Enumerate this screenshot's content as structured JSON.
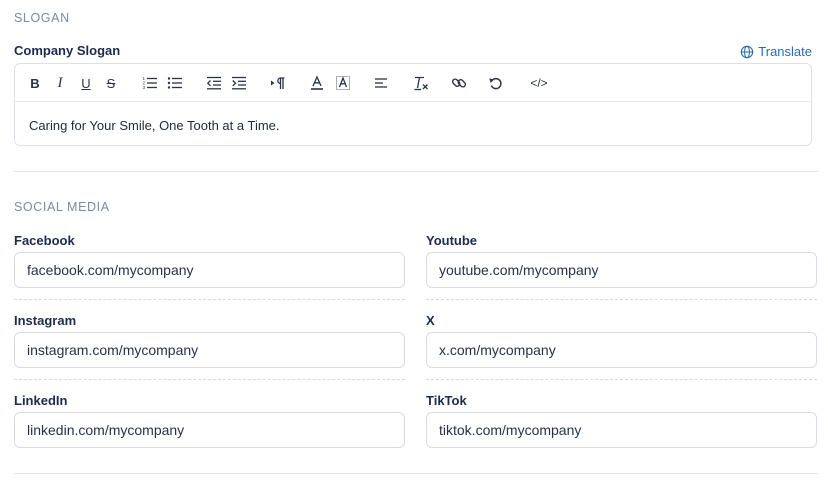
{
  "slogan_section": {
    "title": "SLOGAN",
    "field_label": "Company Slogan",
    "translate_label": "Translate",
    "toolbar": {
      "bold": "B",
      "italic": "I",
      "underline": "U",
      "strike": "S",
      "code": "</>"
    },
    "content": "Caring for Your Smile, One Tooth at a Time."
  },
  "social_section": {
    "title": "SOCIAL MEDIA",
    "fields": [
      {
        "label": "Facebook",
        "value": "facebook.com/mycompany"
      },
      {
        "label": "Youtube",
        "value": "youtube.com/mycompany"
      },
      {
        "label": "Instagram",
        "value": "instagram.com/mycompany"
      },
      {
        "label": "X",
        "value": "x.com/mycompany"
      },
      {
        "label": "LinkedIn",
        "value": "linkedin.com/mycompany"
      },
      {
        "label": "TikTok",
        "value": "tiktok.com/mycompany"
      }
    ]
  },
  "colors": {
    "accent": "#2b6cb0",
    "section_title": "#7a8aa8",
    "label": "#1d2b4f",
    "border": "#d7dce4"
  }
}
